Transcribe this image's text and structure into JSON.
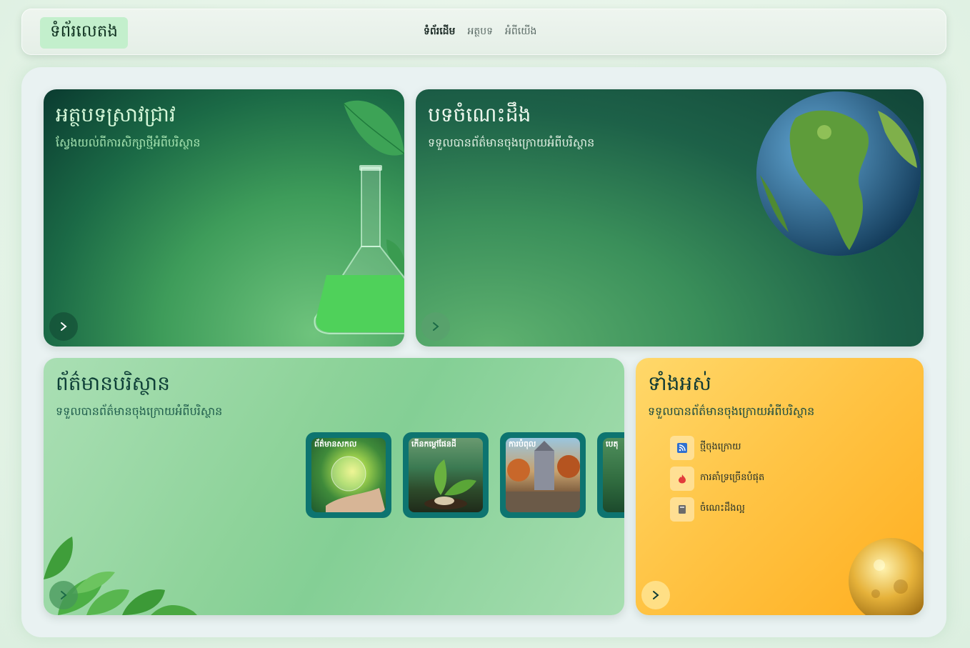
{
  "header": {
    "logo_text": "ទំព័រលេតង",
    "nav": [
      {
        "label": "ទំព័រដើម",
        "active": true
      },
      {
        "label": "អត្ថបទ",
        "active": false
      },
      {
        "label": "អំពីយើង",
        "active": false
      }
    ]
  },
  "cards": {
    "research": {
      "title": "អត្ថបទស្រាវជ្រាវ",
      "subtitle": "ស្វែងយល់ពីការសិក្សាថ្មីអំពីបរិស្ថាន"
    },
    "lessons": {
      "title": "បទចំណេះដឹង",
      "subtitle": "ទទួលបានព័ត៌មានចុងក្រោយអំពីបរិស្ថាន"
    },
    "news": {
      "title": "ព័ត៌មានបរិស្ថាន",
      "subtitle": "ទទួលបានព័ត៌មានចុងក្រោយអំពីបរិស្ថាន",
      "thumbnails": [
        {
          "label": "ព័ត៌មានសកល"
        },
        {
          "label": "កើនកម្តៅផែនដី"
        },
        {
          "label": "ការបំពុល"
        },
        {
          "label": "បេតុ"
        }
      ]
    },
    "all": {
      "title": "ទាំងអស់",
      "subtitle": "ទទួលបានព័ត៌មានចុងក្រោយអំពីបរិស្ថាន",
      "items": [
        {
          "label": "ថ្មីចុងក្រោយ",
          "icon": "rss-icon",
          "color": "#2f6fd0"
        },
        {
          "label": "ការគាំទ្រច្រើនបំផុត",
          "icon": "fire-icon",
          "color": "#e23b3b"
        },
        {
          "label": "ចំណេះដឹងល្អ",
          "icon": "book-icon",
          "color": "#6b6b6b"
        }
      ]
    }
  },
  "colors": {
    "accent_green": "#1b6a46",
    "thumb_border": "#0d7470",
    "card_all_yellow": "#ffc445"
  }
}
